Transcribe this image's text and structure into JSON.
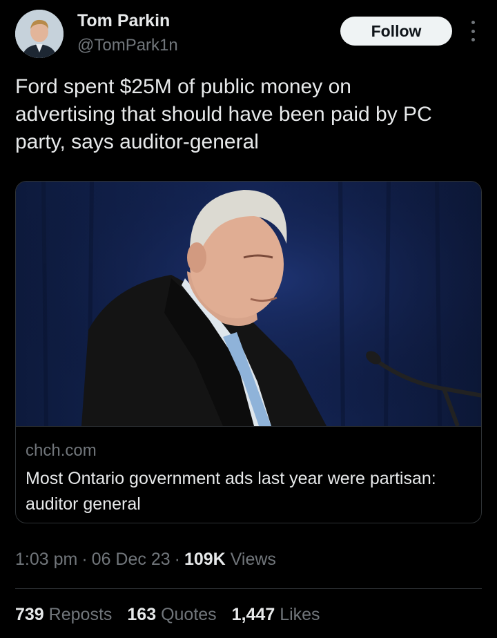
{
  "author": {
    "name": "Tom Parkin",
    "handle": "@TomPark1n"
  },
  "follow_label": "Follow",
  "tweet": {
    "text": "Ford spent $25M of public money on\nadvertising that should have been paid by PC\nparty, says auditor-general"
  },
  "link_card": {
    "domain": "chch.com",
    "title": "Most Ontario government ads last year were partisan: auditor general"
  },
  "meta": {
    "time": "1:03 pm",
    "date": "06 Dec 23",
    "views_count": "109K",
    "views_label": "Views"
  },
  "stats": {
    "reposts_count": "739",
    "reposts_label": "Reposts",
    "quotes_count": "163",
    "quotes_label": "Quotes",
    "likes_count": "1,447",
    "likes_label": "Likes"
  },
  "colors": {
    "background": "#000000",
    "text": "#e7e9ea",
    "muted": "#71767b",
    "border": "#2f3336",
    "follow_button": "#eff3f4"
  },
  "icons": {
    "more": "more-options-icon"
  }
}
